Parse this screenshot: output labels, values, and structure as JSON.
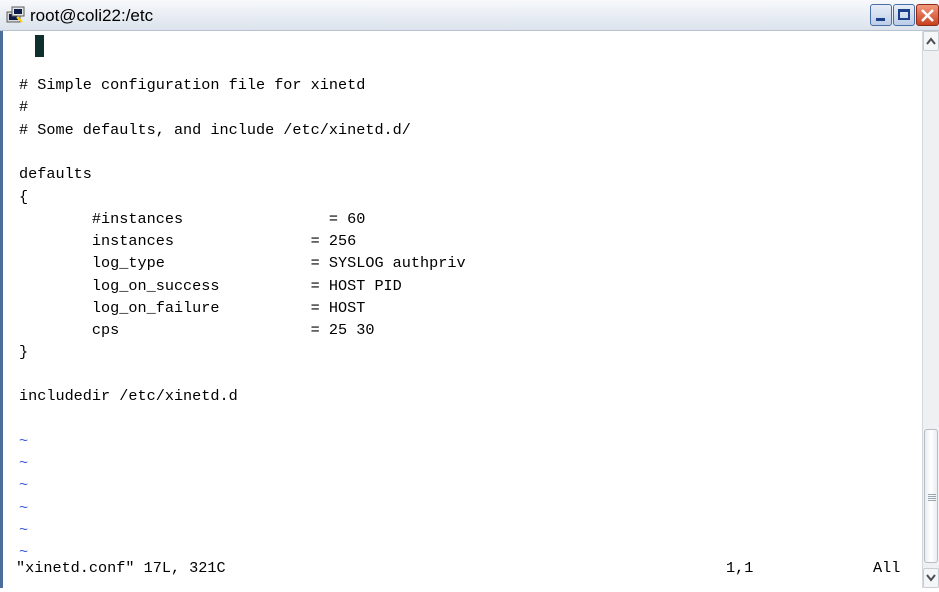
{
  "window": {
    "title": "root@coli22:/etc",
    "icon": "putty-terminal-icon",
    "accent_color": "#4d6d9a"
  },
  "editor": {
    "lines": [
      "#",
      "# Simple configuration file for xinetd",
      "#",
      "# Some defaults, and include /etc/xinetd.d/",
      "",
      "defaults",
      "{",
      "        #instances                = 60",
      "        instances               = 256",
      "        log_type                = SYSLOG authpriv",
      "        log_on_success          = HOST PID",
      "        log_on_failure          = HOST",
      "        cps                     = 25 30",
      "}",
      "",
      "includedir /etc/xinetd.d",
      "",
      "~",
      "~",
      "~",
      "~",
      "~",
      "~"
    ],
    "tilde_color": "#3b5bd8",
    "status": {
      "file": "\"xinetd.conf\" 17L, 321C",
      "position": "1,1",
      "scroll": "All"
    }
  },
  "controls": {
    "minimize": "minimize-icon",
    "maximize": "maximize-icon",
    "close": "close-icon"
  }
}
